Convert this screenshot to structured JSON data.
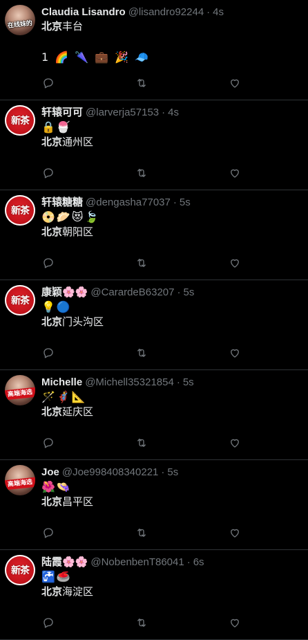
{
  "tweets": [
    {
      "name": "Claudia Lisandro",
      "handle": "@lisandro92244",
      "time": "4s",
      "avatar_text": "在线妹的",
      "line1_bold": "北京",
      "line1_rest": "丰台",
      "line2": "1 🌈 🌂 💼 🎉 🧢"
    },
    {
      "name": "轩辕可可",
      "handle": "@larverja57153",
      "time": "4s",
      "avatar_text": "新茶",
      "emoji_line": "🔒🍧",
      "line_bold": "北京",
      "line_rest": "通州区"
    },
    {
      "name": "轩辕糖糖",
      "handle": "@dengasha77037",
      "time": "5s",
      "avatar_text": "新茶",
      "emoji_line": "📀🥟😻🍃",
      "line_bold": "北京",
      "line_rest": "朝阳区"
    },
    {
      "name": "康颖🌸🌸",
      "handle": "@CarardeB63207",
      "time": "5s",
      "avatar_text": "新茶",
      "emoji_line": "💡🔵",
      "line_bold": "北京",
      "line_rest": "门头沟区"
    },
    {
      "name": "Michelle",
      "handle": "@Michell35321854",
      "time": "5s",
      "avatar_text": "高端海选",
      "emoji_line": "🪄🦸📐",
      "line_bold": "北京",
      "line_rest": "延庆区"
    },
    {
      "name": "Joe",
      "handle": "@Joe998408340221",
      "time": "5s",
      "avatar_text": "高端海选",
      "emoji_line": "🌺👒",
      "line_bold": "北京",
      "line_rest": "昌平区"
    },
    {
      "name": "陆霞🌸🌸",
      "handle": "@NobenbenT86041",
      "time": "6s",
      "avatar_text": "新茶",
      "emoji_line": "🚰🥌",
      "line_bold": "北京",
      "line_rest": "海淀区"
    }
  ],
  "separator": "·",
  "icons": [
    "reply-icon",
    "retweet-icon",
    "like-icon"
  ]
}
